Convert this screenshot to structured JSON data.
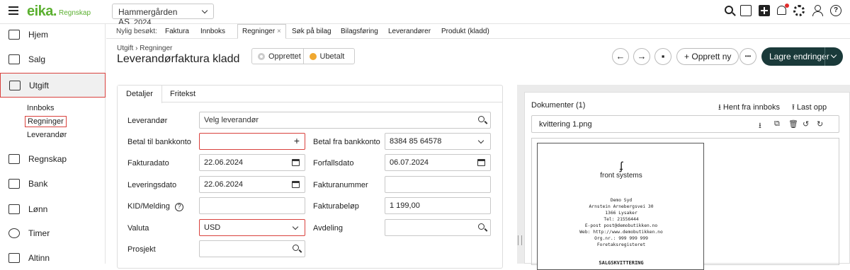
{
  "brand": {
    "logo": "eika.",
    "sub": "Regnskap"
  },
  "company": {
    "name": "Hammergården AS",
    "year": "2024"
  },
  "nav": [
    {
      "label": "Hjem",
      "icon": "chart-icon"
    },
    {
      "label": "Salg",
      "icon": "cart-icon"
    },
    {
      "label": "Utgift",
      "icon": "receipt-icon"
    },
    {
      "label": "Regnskap",
      "icon": "ledger-icon"
    },
    {
      "label": "Bank",
      "icon": "bank-icon"
    },
    {
      "label": "Lønn",
      "icon": "people-icon"
    },
    {
      "label": "Timer",
      "icon": "clock-icon"
    },
    {
      "label": "Altinn",
      "icon": "altinn-icon"
    }
  ],
  "subnav": [
    "Innboks",
    "Regninger",
    "Leverandør"
  ],
  "recent": {
    "label": "Nylig besøkt:",
    "tabs": [
      "Faktura",
      "Innboks",
      "Regninger",
      "Søk på bilag",
      "Bilagsføring",
      "Leverandører",
      "Produkt (kladd)"
    ],
    "close": "×"
  },
  "page": {
    "breadcrumb": "Utgift › Regninger",
    "title": "Leverandørfaktura kladd"
  },
  "status": {
    "created": "Opprettet",
    "unpaid": "Ubetalt",
    "unpaid_color": "#f0a830",
    "created_color": "#bbbbbb"
  },
  "actions": {
    "back": "←",
    "forward": "→",
    "comment": "▪",
    "new": "Opprett ny",
    "new_plus": "+",
    "more": "•••",
    "save": "Lagre endringer",
    "chevron": "⌄"
  },
  "form": {
    "tabs": [
      "Detaljer",
      "Fritekst"
    ],
    "leverandor": {
      "label": "Leverandør",
      "placeholder": "Velg leverandør"
    },
    "betal_til": {
      "label": "Betal til bankkonto",
      "value": "",
      "icon": "+"
    },
    "betal_fra": {
      "label": "Betal fra bankkonto",
      "value": "8384 85 64578"
    },
    "fakturadato": {
      "label": "Fakturadato",
      "value": "22.06.2024"
    },
    "forfallsdato": {
      "label": "Forfallsdato",
      "value": "06.07.2024"
    },
    "leveringsdato": {
      "label": "Leveringsdato",
      "value": "22.06.2024"
    },
    "fakturanummer": {
      "label": "Fakturanummer",
      "value": ""
    },
    "kid": {
      "label": "KID/Melding",
      "value": "",
      "help": "?"
    },
    "fakturabelop": {
      "label": "Fakturabeløp",
      "value": "1 199,00"
    },
    "valuta": {
      "label": "Valuta",
      "value": "USD"
    },
    "avdeling": {
      "label": "Avdeling",
      "value": ""
    },
    "prosjekt": {
      "label": "Prosjekt",
      "value": ""
    }
  },
  "docs": {
    "title": "Dokumenter (1)",
    "fetch": "Hent fra innboks",
    "upload": "Last opp",
    "file": "kvittering 1.png",
    "file_icons": [
      "⭳",
      "⧉",
      "🗑",
      "↺",
      "↻"
    ],
    "receipt": {
      "logo": "ʄ",
      "brand": "front systems",
      "lines": [
        "Demo Syd",
        "Arnstein Arnebergsvei 30",
        "1366  Lysaker",
        "Tel: 21556444",
        "E-post post@demobutikken.no",
        "Web: http://www.demobutikken.no",
        "Org.nr.: 999 999 999",
        "Foretaksregisteret"
      ],
      "title": "SALGSKVITTERING"
    }
  }
}
